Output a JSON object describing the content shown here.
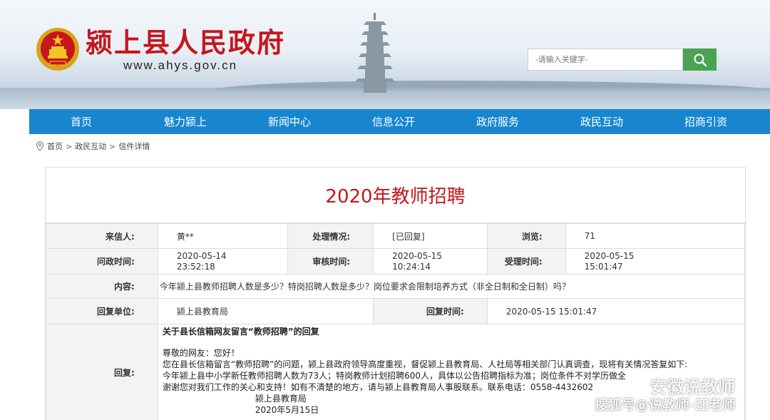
{
  "site": {
    "title": "颍上县人民政府",
    "url": "www.ahys.gov.cn"
  },
  "search": {
    "placeholder": "-请输入关键字-"
  },
  "nav": {
    "items": [
      "首页",
      "魅力颍上",
      "新闻中心",
      "信息公开",
      "政府服务",
      "政民互动",
      "招商引资"
    ]
  },
  "breadcrumb": {
    "items": [
      "首页",
      "政民互动",
      "信件详情"
    ],
    "separator": ">"
  },
  "letter": {
    "title": "2020年教师招聘",
    "sender_label": "来信人:",
    "sender": "黄**",
    "status_label": "处理情况:",
    "status": "[已回复]",
    "views_label": "浏览:",
    "views": "71",
    "ask_time_label": "问政时间:",
    "ask_date": "2020-05-14",
    "ask_time": "23:52:18",
    "review_time_label": "审核时间:",
    "review_date": "2020-05-15",
    "review_time": "10:24:14",
    "accept_time_label": "受理时间:",
    "accept_date": "2020-05-15",
    "accept_time": "15:01:47",
    "content_label": "内容:",
    "content": "今年颍上县教师招聘人数是多少？特岗招聘人数是多少？岗位要求会限制培养方式（非全日制和全日制）吗？",
    "reply_unit_label": "回复单位:",
    "reply_unit": "颍上县教育局",
    "reply_time_label": "回复时间:",
    "reply_time": "2020-05-15 15:01:47",
    "reply_label": "回复:",
    "reply_title": "关于县长信箱网友留言“教师招聘”的回复",
    "reply_greeting": "尊敬的网友：您好！",
    "reply_line1": "您在县长信箱留言“教师招聘”的问题，颍上县政府领导高度重视，督促颍上县教育局、人社局等相关部门认真调查，现将有关情况答复如下:",
    "reply_line2": "今年颍上县中小学新任教师招聘人数为73人；特岗教师计划招聘600人，具体以公告招聘指标为准；岗位条件不对学历做全",
    "reply_line3": "谢谢您对我们工作的关心和支持！如有不清楚的地方，请与颍上县教育局人事股联系。联系电话：0558-4432602",
    "reply_sign": "颍上县教育局",
    "reply_date": "2020年5月15日"
  },
  "watermark": {
    "line1": "安徽说教师",
    "line2": "搜狐号@说教师-汪老师"
  },
  "colors": {
    "nav_bg": "#1786cf",
    "title_red": "#c4171d",
    "search_green": "#4aa253"
  }
}
